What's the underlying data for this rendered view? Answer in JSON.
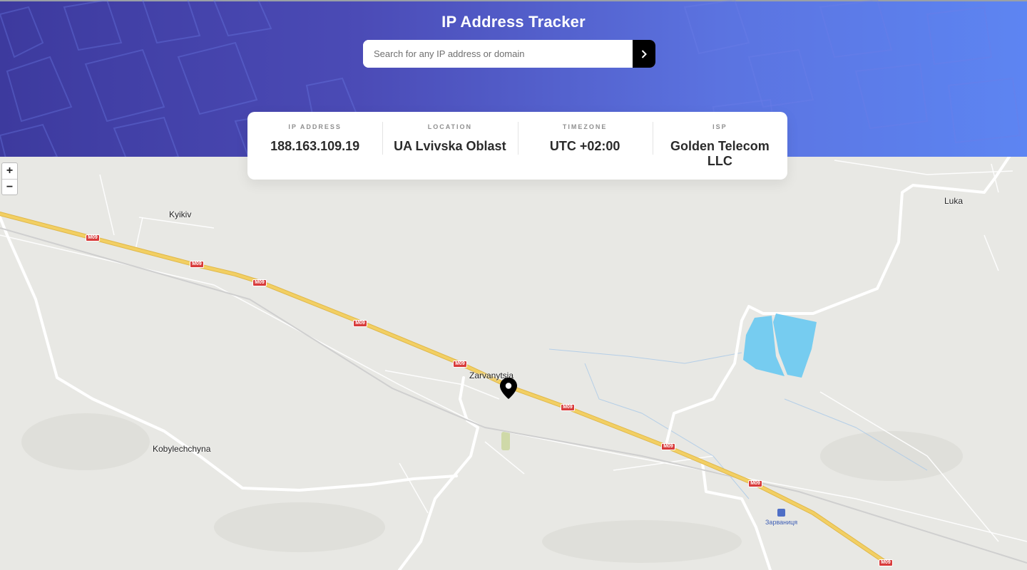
{
  "header": {
    "title": "IP Address Tracker",
    "search_placeholder": "Search for any IP address or domain",
    "search_button_icon": "chevron-right-icon"
  },
  "info": [
    {
      "label": "IP ADDRESS",
      "value": "188.163.109.19"
    },
    {
      "label": "LOCATION",
      "value": "UA Lvivska Oblast"
    },
    {
      "label": "TIMEZONE",
      "value": "UTC +02:00"
    },
    {
      "label": "ISP",
      "value": "Golden Telecom LLC"
    }
  ],
  "map": {
    "zoom_in_label": "+",
    "zoom_out_label": "−",
    "places": [
      "Kyikiv",
      "Zarvanytsia",
      "Kobylechchyna",
      "Luka"
    ],
    "road_label": "M09",
    "poi_label": "Зарваниця",
    "marker_icon": "location-pin-icon"
  },
  "colors": {
    "header_gradient_start": "#3d3a9e",
    "header_gradient_end": "#5d85f2",
    "road_major": "#f2cf63",
    "water": "#76ccf0",
    "shield": "#d83b3b"
  }
}
